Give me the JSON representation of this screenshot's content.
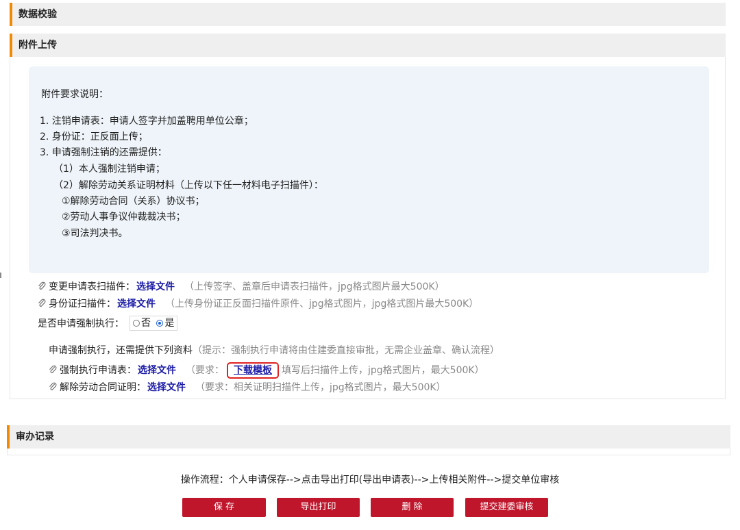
{
  "sections": {
    "validation_title": "数据校验",
    "attach_title": "附件上传",
    "record_title": "审办记录"
  },
  "notice": {
    "heading": "附件要求说明：",
    "lines": [
      "1. 注销申请表：申请人签字并加盖聘用单位公章；",
      "2. 身份证：正反面上传；",
      "3. 申请强制注销的还需提供：",
      "（1）本人强制注销申请；",
      "（2）解除劳动关系证明材料（上传以下任一材料电子扫描件）：",
      "①解除劳动合同（关系）协议书；",
      "②劳动人事争议仲裁裁决书；",
      "③司法判决书。"
    ]
  },
  "uploads": {
    "change_form": {
      "label": "变更申请表扫描件：",
      "choose": "选择文件",
      "hint": "（上传签字、盖章后申请表扫描件，jpg格式图片最大500K）"
    },
    "id_card": {
      "label": "身份证扫描件：",
      "choose": "选择文件",
      "hint": "（上传身份证正反面扫描件原件、jpg格式图片，jpg格式图片最大500K）"
    }
  },
  "enforce": {
    "question": "是否申请强制执行：",
    "no_label": "否",
    "yes_label": "是",
    "selected": "是",
    "notice_label": "申请强制执行，还需提供下列资料",
    "notice_hint": "（提示：强制执行申请将由住建委直接审批，无需企业盖章、确认流程）",
    "form": {
      "label": "强制执行申请表：",
      "choose": "选择文件",
      "hint_prefix": "（要求：",
      "download": "下载模板",
      "hint_suffix": "填写后扫描件上传，jpg格式图片，最大500K）"
    },
    "contract": {
      "label": "解除劳动合同证明：",
      "choose": "选择文件",
      "hint": "（要求：相关证明扫描件上传，jpg格式图片，最大500K）"
    }
  },
  "flow": "操作流程：个人申请保存-->点击导出打印(导出申请表)-->上传相关附件-->提交单位审核",
  "buttons": {
    "save": "保 存",
    "export": "导出打印",
    "delete": "删 除",
    "submit": "提交建委审核"
  },
  "colors": {
    "accent": "#f08a00",
    "button": "#c0162c",
    "link": "#1a1aa6",
    "highlight": "#e02020"
  }
}
